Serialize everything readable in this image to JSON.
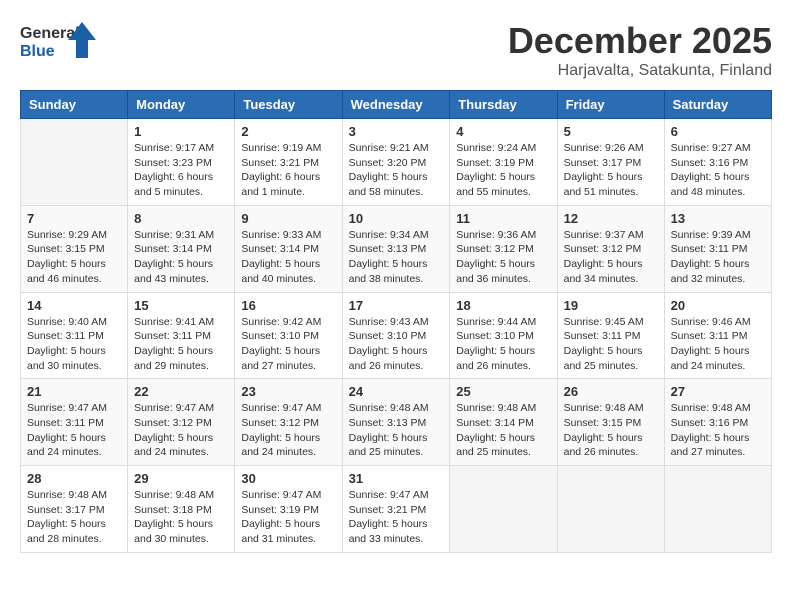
{
  "header": {
    "logo_general": "General",
    "logo_blue": "Blue",
    "month_year": "December 2025",
    "location": "Harjavalta, Satakunta, Finland"
  },
  "weekdays": [
    "Sunday",
    "Monday",
    "Tuesday",
    "Wednesday",
    "Thursday",
    "Friday",
    "Saturday"
  ],
  "weeks": [
    [
      {
        "day": "",
        "info": ""
      },
      {
        "day": "1",
        "info": "Sunrise: 9:17 AM\nSunset: 3:23 PM\nDaylight: 6 hours\nand 5 minutes."
      },
      {
        "day": "2",
        "info": "Sunrise: 9:19 AM\nSunset: 3:21 PM\nDaylight: 6 hours\nand 1 minute."
      },
      {
        "day": "3",
        "info": "Sunrise: 9:21 AM\nSunset: 3:20 PM\nDaylight: 5 hours\nand 58 minutes."
      },
      {
        "day": "4",
        "info": "Sunrise: 9:24 AM\nSunset: 3:19 PM\nDaylight: 5 hours\nand 55 minutes."
      },
      {
        "day": "5",
        "info": "Sunrise: 9:26 AM\nSunset: 3:17 PM\nDaylight: 5 hours\nand 51 minutes."
      },
      {
        "day": "6",
        "info": "Sunrise: 9:27 AM\nSunset: 3:16 PM\nDaylight: 5 hours\nand 48 minutes."
      }
    ],
    [
      {
        "day": "7",
        "info": "Sunrise: 9:29 AM\nSunset: 3:15 PM\nDaylight: 5 hours\nand 46 minutes."
      },
      {
        "day": "8",
        "info": "Sunrise: 9:31 AM\nSunset: 3:14 PM\nDaylight: 5 hours\nand 43 minutes."
      },
      {
        "day": "9",
        "info": "Sunrise: 9:33 AM\nSunset: 3:14 PM\nDaylight: 5 hours\nand 40 minutes."
      },
      {
        "day": "10",
        "info": "Sunrise: 9:34 AM\nSunset: 3:13 PM\nDaylight: 5 hours\nand 38 minutes."
      },
      {
        "day": "11",
        "info": "Sunrise: 9:36 AM\nSunset: 3:12 PM\nDaylight: 5 hours\nand 36 minutes."
      },
      {
        "day": "12",
        "info": "Sunrise: 9:37 AM\nSunset: 3:12 PM\nDaylight: 5 hours\nand 34 minutes."
      },
      {
        "day": "13",
        "info": "Sunrise: 9:39 AM\nSunset: 3:11 PM\nDaylight: 5 hours\nand 32 minutes."
      }
    ],
    [
      {
        "day": "14",
        "info": "Sunrise: 9:40 AM\nSunset: 3:11 PM\nDaylight: 5 hours\nand 30 minutes."
      },
      {
        "day": "15",
        "info": "Sunrise: 9:41 AM\nSunset: 3:11 PM\nDaylight: 5 hours\nand 29 minutes."
      },
      {
        "day": "16",
        "info": "Sunrise: 9:42 AM\nSunset: 3:10 PM\nDaylight: 5 hours\nand 27 minutes."
      },
      {
        "day": "17",
        "info": "Sunrise: 9:43 AM\nSunset: 3:10 PM\nDaylight: 5 hours\nand 26 minutes."
      },
      {
        "day": "18",
        "info": "Sunrise: 9:44 AM\nSunset: 3:10 PM\nDaylight: 5 hours\nand 26 minutes."
      },
      {
        "day": "19",
        "info": "Sunrise: 9:45 AM\nSunset: 3:11 PM\nDaylight: 5 hours\nand 25 minutes."
      },
      {
        "day": "20",
        "info": "Sunrise: 9:46 AM\nSunset: 3:11 PM\nDaylight: 5 hours\nand 24 minutes."
      }
    ],
    [
      {
        "day": "21",
        "info": "Sunrise: 9:47 AM\nSunset: 3:11 PM\nDaylight: 5 hours\nand 24 minutes."
      },
      {
        "day": "22",
        "info": "Sunrise: 9:47 AM\nSunset: 3:12 PM\nDaylight: 5 hours\nand 24 minutes."
      },
      {
        "day": "23",
        "info": "Sunrise: 9:47 AM\nSunset: 3:12 PM\nDaylight: 5 hours\nand 24 minutes."
      },
      {
        "day": "24",
        "info": "Sunrise: 9:48 AM\nSunset: 3:13 PM\nDaylight: 5 hours\nand 25 minutes."
      },
      {
        "day": "25",
        "info": "Sunrise: 9:48 AM\nSunset: 3:14 PM\nDaylight: 5 hours\nand 25 minutes."
      },
      {
        "day": "26",
        "info": "Sunrise: 9:48 AM\nSunset: 3:15 PM\nDaylight: 5 hours\nand 26 minutes."
      },
      {
        "day": "27",
        "info": "Sunrise: 9:48 AM\nSunset: 3:16 PM\nDaylight: 5 hours\nand 27 minutes."
      }
    ],
    [
      {
        "day": "28",
        "info": "Sunrise: 9:48 AM\nSunset: 3:17 PM\nDaylight: 5 hours\nand 28 minutes."
      },
      {
        "day": "29",
        "info": "Sunrise: 9:48 AM\nSunset: 3:18 PM\nDaylight: 5 hours\nand 30 minutes."
      },
      {
        "day": "30",
        "info": "Sunrise: 9:47 AM\nSunset: 3:19 PM\nDaylight: 5 hours\nand 31 minutes."
      },
      {
        "day": "31",
        "info": "Sunrise: 9:47 AM\nSunset: 3:21 PM\nDaylight: 5 hours\nand 33 minutes."
      },
      {
        "day": "",
        "info": ""
      },
      {
        "day": "",
        "info": ""
      },
      {
        "day": "",
        "info": ""
      }
    ]
  ]
}
